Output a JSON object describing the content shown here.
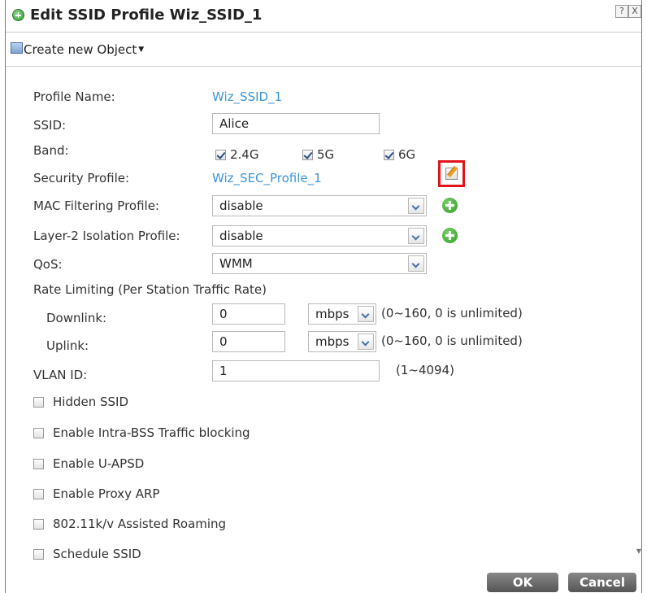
{
  "window": {
    "title": "Edit SSID Profile Wiz_SSID_1",
    "help_button": "?",
    "close_button": "X"
  },
  "toolbar": {
    "create_object_label": "Create new Object"
  },
  "form": {
    "profile_name": {
      "label": "Profile Name:",
      "value": "Wiz_SSID_1"
    },
    "ssid": {
      "label": "SSID:",
      "value": "Alice"
    },
    "band": {
      "label": "Band:",
      "options": [
        {
          "label": "2.4G",
          "checked": true
        },
        {
          "label": "5G",
          "checked": true
        },
        {
          "label": "6G",
          "checked": true
        }
      ]
    },
    "security_profile": {
      "label": "Security Profile:",
      "value": "Wiz_SEC_Profile_1"
    },
    "mac_filtering": {
      "label": "MAC Filtering Profile:",
      "value": "disable"
    },
    "layer2_isolation": {
      "label": "Layer-2 Isolation Profile:",
      "value": "disable"
    },
    "qos": {
      "label": "QoS:",
      "value": "WMM"
    },
    "rate_limiting": {
      "label": "Rate Limiting (Per Station Traffic Rate)",
      "downlink": {
        "label": "Downlink:",
        "value": "0",
        "unit": "mbps",
        "hint": "(0~160, 0 is unlimited)"
      },
      "uplink": {
        "label": "Uplink:",
        "value": "0",
        "unit": "mbps",
        "hint": "(0~160, 0 is unlimited)"
      }
    },
    "vlan_id": {
      "label": "VLAN ID:",
      "value": "1",
      "hint": "(1~4094)"
    },
    "checkboxes": [
      {
        "label": "Hidden SSID",
        "checked": false
      },
      {
        "label": "Enable Intra-BSS Traffic blocking",
        "checked": false
      },
      {
        "label": "Enable U-APSD",
        "checked": false
      },
      {
        "label": "Enable Proxy ARP",
        "checked": false
      },
      {
        "label": "802.11k/v Assisted Roaming",
        "checked": false
      },
      {
        "label": "Schedule SSID",
        "checked": false
      }
    ]
  },
  "footer": {
    "ok_label": "OK",
    "cancel_label": "Cancel"
  },
  "colors": {
    "link": "#3c96d8",
    "highlight": "#e0141b",
    "add_icon": "#2f9a23"
  }
}
